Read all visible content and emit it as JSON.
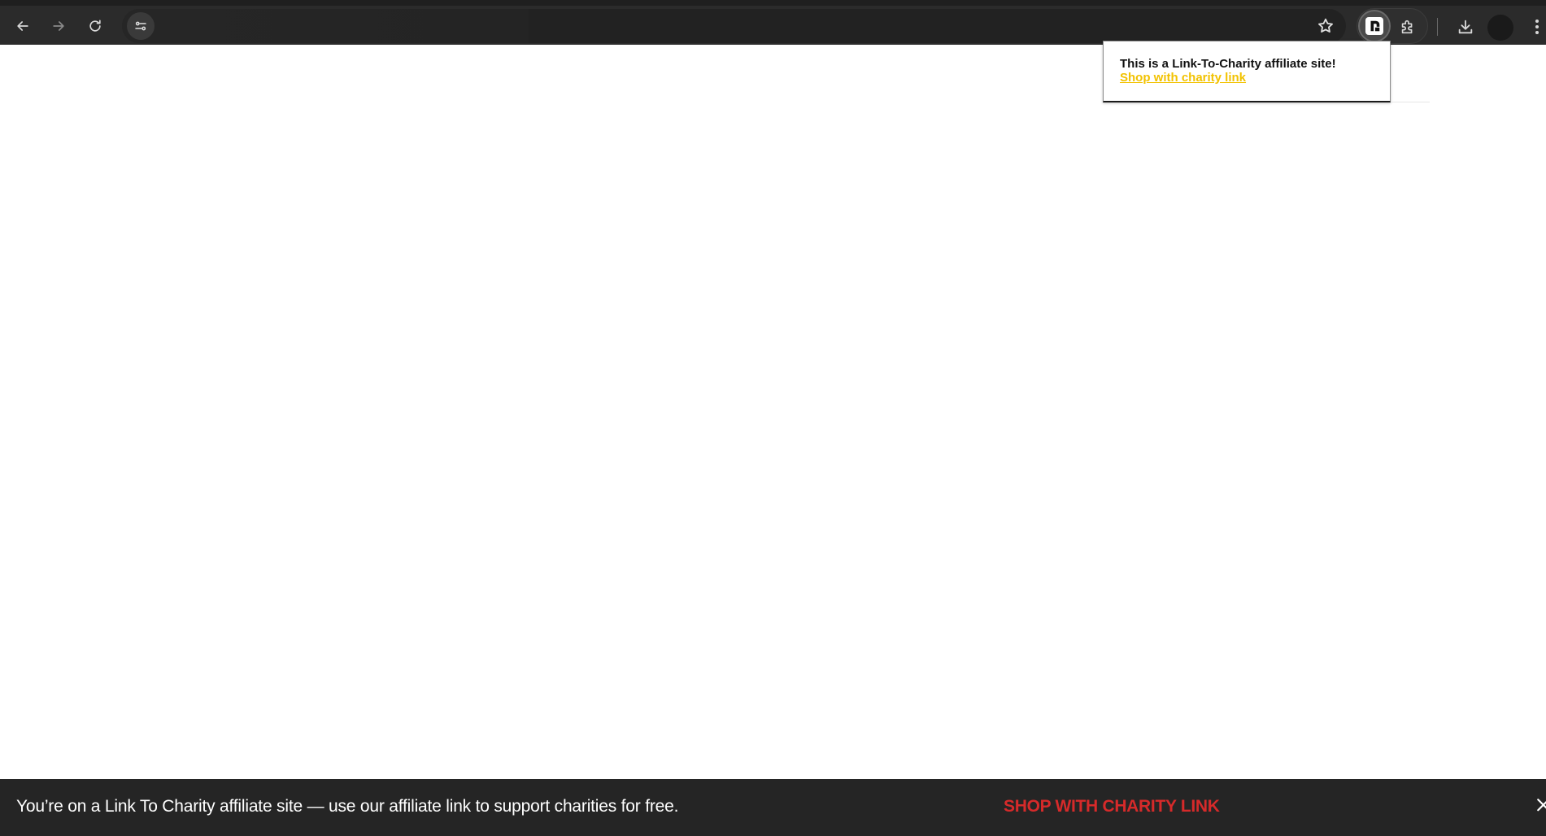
{
  "browser": {
    "icons": {
      "back": "arrow-left-icon",
      "forward": "arrow-right-icon",
      "reload": "reload-icon",
      "site_info": "tune-icon",
      "bookmark": "star-icon",
      "extension_active": "link-to-charity-extension-icon",
      "extensions": "puzzle-icon",
      "downloads": "download-icon",
      "profile": "avatar",
      "menu": "kebab-menu-icon"
    },
    "colors": {
      "toolbar": "#2b2b2b",
      "omnibox": "#222222",
      "icon": "#d8d8d8"
    }
  },
  "popup": {
    "message": "This is a Link-To-Charity affiliate site!",
    "link_label": "Shop with charity link",
    "link_color": "#f2c200"
  },
  "banner": {
    "message": "You’re on a Link To Charity affiliate site — use our affiliate link to support charities for free.",
    "cta_label": "SHOP WITH CHARITY LINK",
    "cta_color": "#d62a2a",
    "close_icon": "close-icon",
    "background": "#252525"
  }
}
